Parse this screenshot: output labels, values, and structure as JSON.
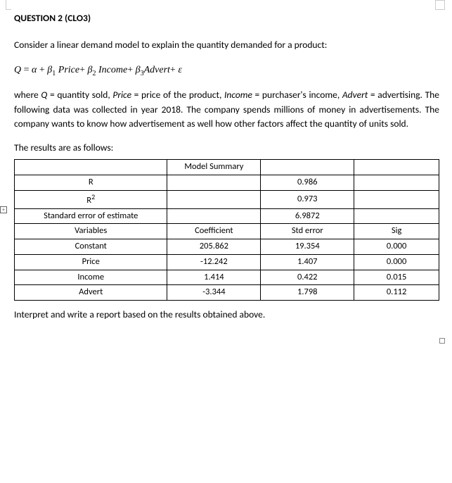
{
  "title": "QUESTION 2 (CLO3)",
  "intro": "Consider a linear demand model to explain the quantity demanded for a product:",
  "equation": {
    "lhs": "Q",
    "eq": " = ",
    "alpha": "α",
    "plus1": " + ",
    "b1": "β",
    "s1": "1",
    "v1": " Price",
    "plus2": "+ ",
    "b2": "β",
    "s2": "2",
    "v2": " Income",
    "plus3": "+ ",
    "b3": "β",
    "s3": "3",
    "v3": "Advert",
    "plus4": "+ ",
    "eps": "ε"
  },
  "where": {
    "part1": "where ",
    "Q": "Q",
    "part2": " = quantity sold, ",
    "Price": "Price",
    "part3": " = price of the product, ",
    "Income": "Income",
    "part4": " = purchaser's income, ",
    "Advert": "Advert",
    "part5": " = advertising. The following data was collected in year 2018. The company spends millions of money in advertisements. The company wants to know how advertisement as well how other factors affect the quantity of units sold."
  },
  "results_line": "The results are as follows:",
  "table": {
    "header": "Model Summary",
    "stats": [
      {
        "label": "R",
        "value": "0.986"
      },
      {
        "label_html": "R2",
        "label": "R",
        "sup": "2",
        "value": "0.973"
      },
      {
        "label": "Standard error of estimate",
        "value": "6.9872"
      }
    ],
    "var_header": {
      "c1": "Variables",
      "c2": "Coefficient",
      "c3": "Std error",
      "c4": "Sig"
    },
    "rows": [
      {
        "c1": "Constant",
        "c2": "205.862",
        "c3": "19.354",
        "c4": "0.000"
      },
      {
        "c1": "Price",
        "c2": "-12.242",
        "c3": "1.407",
        "c4": "0.000"
      },
      {
        "c1": "Income",
        "c2": "1.414",
        "c3": "0.422",
        "c4": "0.015"
      },
      {
        "c1": "Advert",
        "c2": "-3.344",
        "c3": "1.798",
        "c4": "0.112"
      }
    ]
  },
  "closing": "Interpret and write a report based on the results obtained above.",
  "icons": {
    "plus": "+"
  }
}
